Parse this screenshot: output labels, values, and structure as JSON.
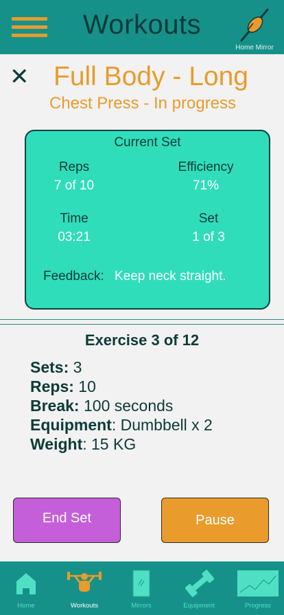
{
  "header": {
    "title": "Workouts",
    "mirror_label": "Home Mirror"
  },
  "workout": {
    "title": "Full Body - Long",
    "subtitle": "Chest Press - In progress"
  },
  "current_set": {
    "title": "Current Set",
    "reps_label": "Reps",
    "reps_value": "7 of 10",
    "efficiency_label": "Efficiency",
    "efficiency_value": "71%",
    "time_label": "Time",
    "time_value": "03:21",
    "set_label": "Set",
    "set_value": "1 of 3",
    "feedback_label": "Feedback:",
    "feedback_text": "Keep neck straight."
  },
  "exercise": {
    "heading": "Exercise 3 of 12",
    "sets_label": "Sets:",
    "sets_value": " 3",
    "reps_label": "Reps:",
    "reps_value": " 10",
    "break_label": "Break:",
    "break_value": " 100 seconds",
    "equipment_label": "Equipment",
    "equipment_value": ": Dumbbell x 2",
    "weight_label": "Weight",
    "weight_value": ": 15 KG"
  },
  "buttons": {
    "end_set": "End Set",
    "pause": "Pause"
  },
  "nav": {
    "items": [
      {
        "label": "Home",
        "icon": "home-icon",
        "active": false
      },
      {
        "label": "Workouts",
        "icon": "weightlifter-icon",
        "active": true
      },
      {
        "label": "Mirrors",
        "icon": "mirror-icon",
        "active": false
      },
      {
        "label": "Equipment",
        "icon": "dumbbell-icon",
        "active": false
      },
      {
        "label": "Progress",
        "icon": "progress-chart-icon",
        "active": false
      }
    ]
  },
  "colors": {
    "header_bg": "#16918a",
    "accent_orange": "#e99b2b",
    "card_bg": "#30ddbb",
    "dark_text": "#0d3a37",
    "end_set_bg": "#c55fd9",
    "nav_inactive": "#4fe0c4"
  }
}
